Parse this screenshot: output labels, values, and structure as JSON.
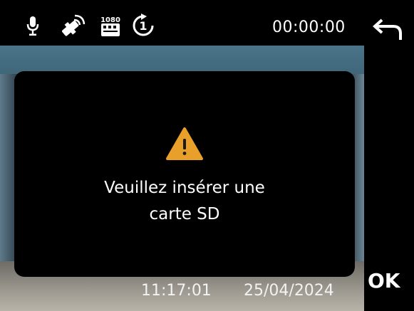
{
  "status_bar": {
    "icons": [
      "microphone-icon",
      "satellite-gps-icon",
      "resolution-1080p-icon",
      "loop-recording-1min-icon"
    ],
    "recording_time": "00:00:00"
  },
  "dialog": {
    "icon": "warning-icon",
    "message_line1": "Veuillez insérer une",
    "message_line2": "carte SD"
  },
  "overlay": {
    "time": "11:17:01",
    "date": "25/04/2024"
  },
  "controls": {
    "back_icon": "back-arrow-icon",
    "ok_label": "OK"
  },
  "colors": {
    "warning": "#e8a02a",
    "text": "#ffffff",
    "background": "#000000"
  }
}
